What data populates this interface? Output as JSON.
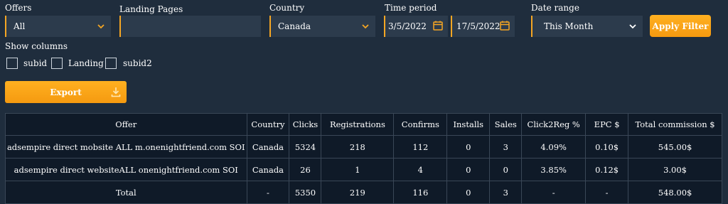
{
  "filters": {
    "offers": {
      "label": "Offers",
      "value": "All"
    },
    "landing": {
      "label": "Landing Pages",
      "value": ""
    },
    "country": {
      "label": "Country",
      "value": "Canada"
    },
    "time": {
      "label": "Time period",
      "from": "3/5/2022",
      "to": "17/5/2022"
    },
    "range": {
      "label": "Date range",
      "value": "This Month"
    },
    "apply_label": "Apply Filter"
  },
  "columns": {
    "label": "Show columns",
    "options": [
      "subid",
      "Landing",
      "subid2"
    ]
  },
  "export_label": "Export",
  "table": {
    "headers": [
      "Offer",
      "Country",
      "Clicks",
      "Registrations",
      "Confirms",
      "Installs",
      "Sales",
      "Click2Reg %",
      "EPC $",
      "Total commission $"
    ],
    "rows": [
      [
        "adsempire direct mobsite ALL m.onenightfriend.com SOI",
        "Canada",
        "5324",
        "218",
        "112",
        "0",
        "3",
        "4.09%",
        "0.10$",
        "545.00$"
      ],
      [
        "adsempire direct websiteALL onenightfriend.com SOI",
        "Canada",
        "26",
        "1",
        "4",
        "0",
        "0",
        "3.85%",
        "0.12$",
        "3.00$"
      ],
      [
        "Total",
        "-",
        "5350",
        "219",
        "116",
        "0",
        "3",
        "-",
        "-",
        "548.00$"
      ]
    ]
  },
  "colors": {
    "accent": "#f5a623",
    "background": "#1f2d3d",
    "field": "#2c3b4c",
    "table": "#0f1a28"
  }
}
